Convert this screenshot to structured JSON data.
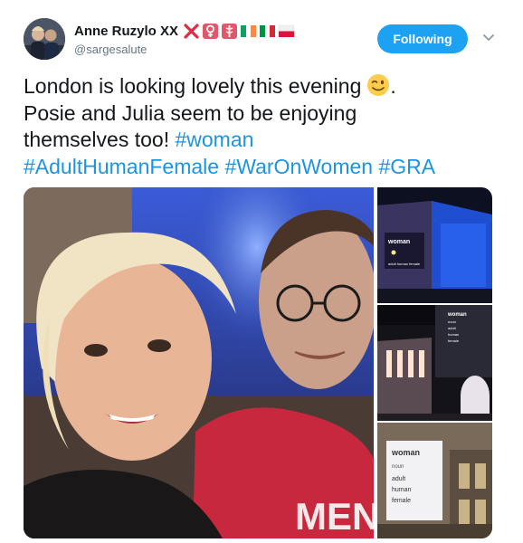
{
  "tweet": {
    "author_name": "Anne Ruzylo XX",
    "author_handle": "@sargesalute",
    "follow_label": "Following",
    "text_line1": "London is looking lovely this evening",
    "text_line1_end": ".",
    "text_line2": "Posie and Julia seem to be enjoying",
    "text_line3": "themselves too!",
    "hashtags": [
      "#woman",
      "#AdultHumanFemale",
      "#WarOnWomen",
      "#GRA"
    ]
  },
  "name_emojis": [
    "cross-mark-icon",
    "female-sign-icon",
    "medical-symbol-icon",
    "ireland-flag-icon",
    "italy-flag-icon",
    "poland-flag-icon"
  ],
  "text_emoji": "winking-face-icon",
  "media": {
    "main_shirt_text": "MEN",
    "sign1_lines": [
      "woman",
      "adult human female"
    ],
    "sign2_lines": [
      "woman",
      "noun",
      "adult",
      "human",
      "female"
    ],
    "sign3_lines": [
      "woman",
      "noun",
      "adult",
      "human",
      "female"
    ]
  },
  "colors": {
    "accent": "#1da1f2",
    "hashtag": "#1b95e0",
    "text": "#14171a",
    "muted": "#657786"
  }
}
